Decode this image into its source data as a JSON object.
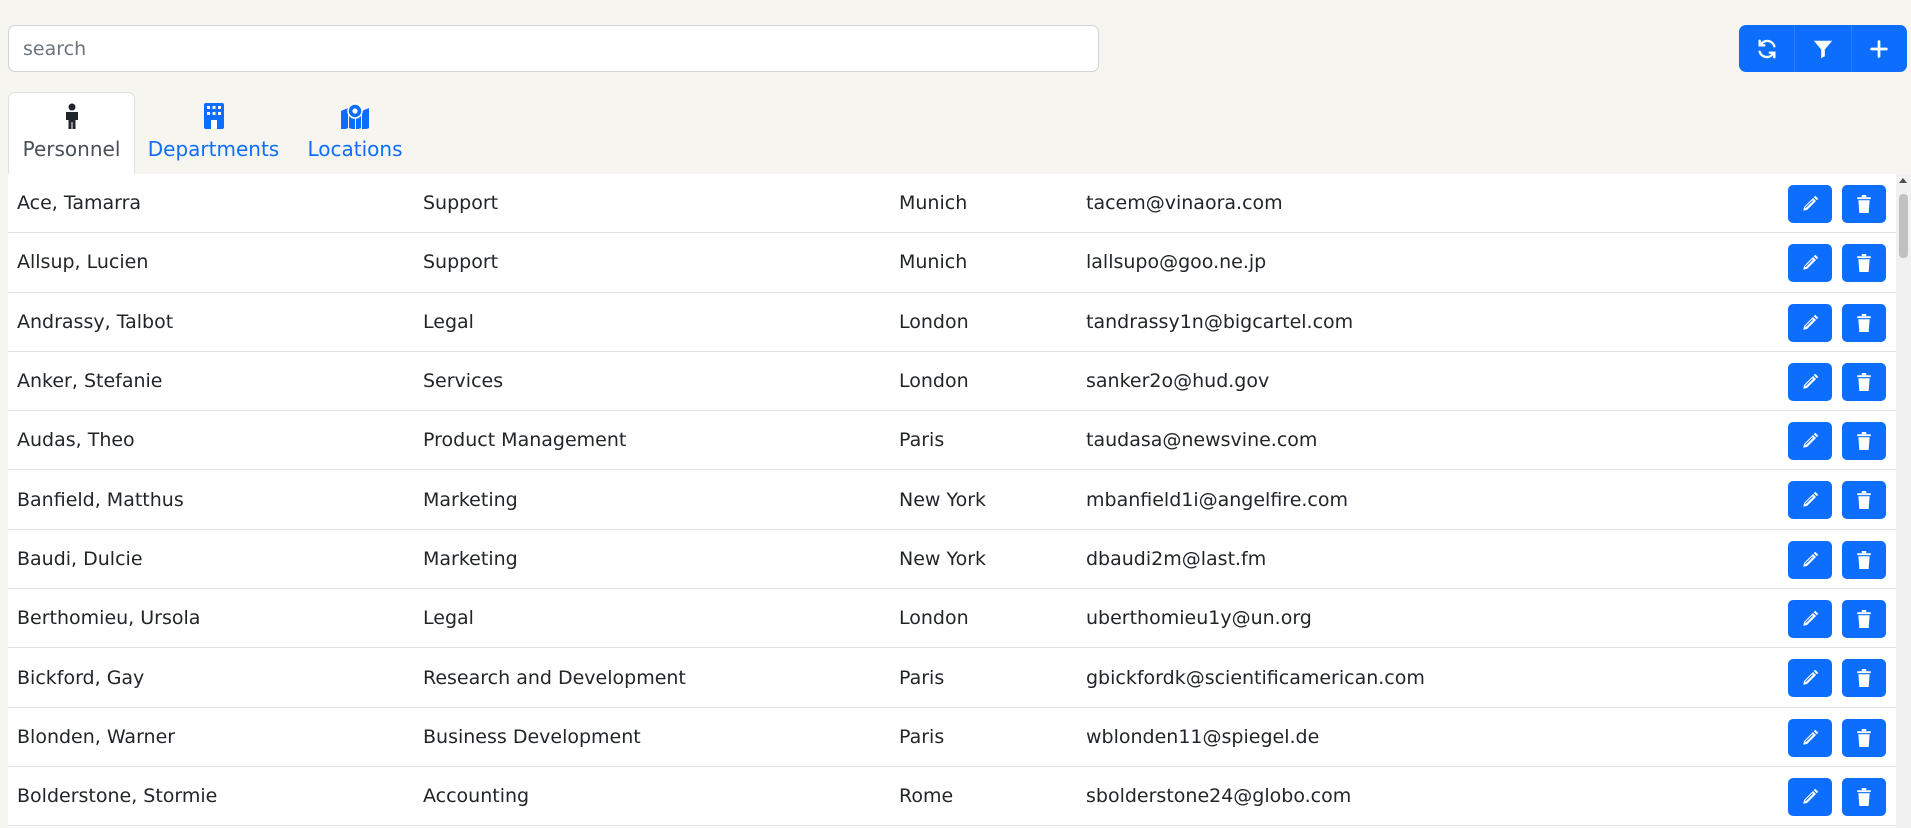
{
  "search": {
    "placeholder": "search",
    "value": ""
  },
  "toolbar": {
    "buttons": [
      {
        "name": "refresh",
        "icon": "refresh-icon"
      },
      {
        "name": "filter",
        "icon": "filter-icon"
      },
      {
        "name": "add",
        "icon": "plus-icon"
      }
    ]
  },
  "tabs": [
    {
      "label": "Personnel",
      "icon": "person-icon",
      "active": true
    },
    {
      "label": "Departments",
      "icon": "building-icon",
      "active": false
    },
    {
      "label": "Locations",
      "icon": "map-marker-icon",
      "active": false
    }
  ],
  "accent_color": "#0d6efd",
  "rows": [
    {
      "name": "Ace, Tamarra",
      "department": "Support",
      "location": "Munich",
      "email": "tacem@vinaora.com"
    },
    {
      "name": "Allsup, Lucien",
      "department": "Support",
      "location": "Munich",
      "email": "lallsupo@goo.ne.jp"
    },
    {
      "name": "Andrassy, Talbot",
      "department": "Legal",
      "location": "London",
      "email": "tandrassy1n@bigcartel.com"
    },
    {
      "name": "Anker, Stefanie",
      "department": "Services",
      "location": "London",
      "email": "sanker2o@hud.gov"
    },
    {
      "name": "Audas, Theo",
      "department": "Product Management",
      "location": "Paris",
      "email": "taudasa@newsvine.com"
    },
    {
      "name": "Banfield, Matthus",
      "department": "Marketing",
      "location": "New York",
      "email": "mbanfield1i@angelfire.com"
    },
    {
      "name": "Baudi, Dulcie",
      "department": "Marketing",
      "location": "New York",
      "email": "dbaudi2m@last.fm"
    },
    {
      "name": "Berthomieu, Ursola",
      "department": "Legal",
      "location": "London",
      "email": "uberthomieu1y@un.org"
    },
    {
      "name": "Bickford, Gay",
      "department": "Research and Development",
      "location": "Paris",
      "email": "gbickfordk@scientificamerican.com"
    },
    {
      "name": "Blonden, Warner",
      "department": "Business Development",
      "location": "Paris",
      "email": "wblonden11@spiegel.de"
    },
    {
      "name": "Bolderstone, Stormie",
      "department": "Accounting",
      "location": "Rome",
      "email": "sbolderstone24@globo.com"
    }
  ]
}
